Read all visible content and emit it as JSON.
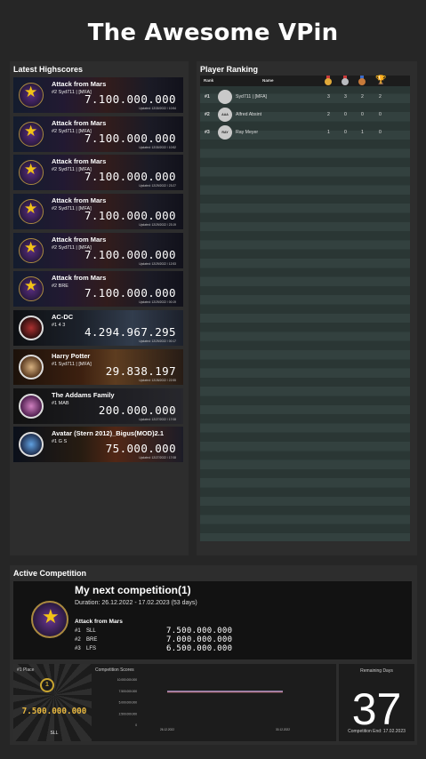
{
  "app": {
    "title": "The Awesome VPin"
  },
  "highscores": {
    "title": "Latest Highscores",
    "items": [
      {
        "game": "Attack from Mars",
        "player": "#2   Syd711 | [MFA]",
        "score": "7.100.000.000",
        "updated": "Updated: 12/30/2022 / 10:54",
        "logo": "attack-from-mars-logo"
      },
      {
        "game": "Attack from Mars",
        "player": "#2   Syd711 | [MFA]",
        "score": "7.100.000.000",
        "updated": "Updated: 12/30/2022 / 10:52",
        "logo": "attack-from-mars-logo"
      },
      {
        "game": "Attack from Mars",
        "player": "#2   Syd711 | [MFA]",
        "score": "7.100.000.000",
        "updated": "Updated: 12/29/2022 / 23:27",
        "logo": "attack-from-mars-logo"
      },
      {
        "game": "Attack from Mars",
        "player": "#2   Syd711 | [MFA]",
        "score": "7.100.000.000",
        "updated": "Updated: 12/29/2022 / 23:19",
        "logo": "attack-from-mars-logo"
      },
      {
        "game": "Attack from Mars",
        "player": "#2   Syd711 | [MFA]",
        "score": "7.100.000.000",
        "updated": "Updated: 12/29/2022 / 12:53",
        "logo": "attack-from-mars-logo"
      },
      {
        "game": "Attack from Mars",
        "player": "#2   BRE",
        "score": "7.100.000.000",
        "updated": "Updated: 12/29/2022 / 00:19",
        "logo": "attack-from-mars-logo"
      },
      {
        "game": "AC-DC",
        "player": "#1   4 3",
        "score": "4.294.967.295",
        "updated": "Updated: 12/29/2022 / 00:17",
        "logo": "acdc-logo"
      },
      {
        "game": "Harry Potter",
        "player": "#1   Syd711 | [MFA]",
        "score": "29.838.197",
        "updated": "Updated: 12/28/2022 / 22:55",
        "logo": "harry-potter-logo"
      },
      {
        "game": "The Addams Family",
        "player": "#1   MAB",
        "score": "200.000.000",
        "updated": "Updated: 12/27/2022 / 17:08",
        "logo": "addams-family-logo"
      },
      {
        "game": "Avatar (Stern 2012)_Bigus(MOD)2.1",
        "player": "#1   G S",
        "score": "75.000.000",
        "updated": "Updated: 12/27/2022 / 17:08",
        "logo": "avatar-logo"
      }
    ]
  },
  "ranking": {
    "title": "Player Ranking",
    "columns": {
      "rank": "Rank",
      "name": "Name"
    },
    "medals": [
      {
        "name": "gold-medal-icon",
        "color": "#e0a93a"
      },
      {
        "name": "silver-medal-icon",
        "color": "#b9bcc0"
      },
      {
        "name": "bronze-medal-icon",
        "color": "#c87a3a"
      },
      {
        "name": "trophy-icon",
        "color": "#e0a93a"
      }
    ],
    "rows": [
      {
        "rank": "#1",
        "name": "Syd711 | [MFA]",
        "avatar": "",
        "c1": "3",
        "c2": "3",
        "c3": "2",
        "c4": "2"
      },
      {
        "rank": "#2",
        "name": "Alfred Absint",
        "avatar": "AAA",
        "c1": "2",
        "c2": "0",
        "c3": "0",
        "c4": "0"
      },
      {
        "rank": "#3",
        "name": "Ray Meyer",
        "avatar": "RAY",
        "c1": "1",
        "c2": "0",
        "c3": "1",
        "c4": "0"
      }
    ]
  },
  "competition": {
    "title": "Active Competition",
    "name": "My next competition(1)",
    "duration": "Duration: 26.12.2022 - 17.02.2023 (53 days)",
    "game": "Attack from Mars",
    "scores": [
      {
        "pos": "#1",
        "player": "SLL",
        "score": "7.500.000.000"
      },
      {
        "pos": "#2",
        "player": "BRE",
        "score": "7.000.000.000"
      },
      {
        "pos": "#3",
        "player": "LFS",
        "score": "6.500.000.000"
      }
    ],
    "first_place": {
      "label": "#1 Place",
      "badge": "1",
      "score": "7.500.000.000",
      "player": "SLL"
    },
    "chart_title": "Competition Scores",
    "remaining": {
      "label": "Remaining Days",
      "days": "37",
      "end": "Competition End: 17.02.2023"
    }
  },
  "chart_data": {
    "type": "line",
    "title": "Competition Scores",
    "x": [
      "26.12.2022",
      "30.12.2022"
    ],
    "series": [
      {
        "values": [
          7500000000,
          7500000000
        ],
        "color": "#c8a8d8"
      },
      {
        "values": [
          7400000000,
          7400000000
        ],
        "color": "#7a8ad8"
      },
      {
        "values": [
          7300000000,
          7300000000
        ],
        "color": "#e07a7a"
      }
    ],
    "ylim": [
      0,
      10000000000
    ],
    "yticks": [
      "10.000.000.000",
      "7.500.000.000",
      "5.000.000.000",
      "2.500.000.000",
      "0"
    ],
    "xticks": [
      "26.12.2022",
      "30.12.2022"
    ],
    "grid": false
  }
}
